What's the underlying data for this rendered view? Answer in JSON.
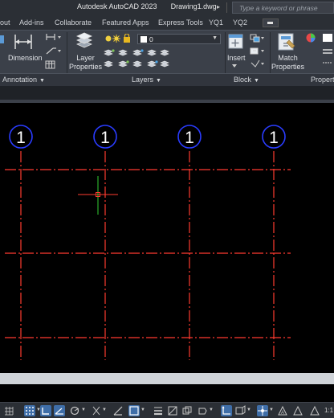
{
  "title_bar": {
    "app_title": "Autodesk AutoCAD 2023",
    "file_name": "Drawing1.dwg",
    "search_placeholder": "Type a keyword or phrase"
  },
  "ribbon_tabs": [
    "out",
    "Add-ins",
    "Collaborate",
    "Featured Apps",
    "Express Tools",
    "YQ1",
    "YQ2"
  ],
  "ribbon": {
    "annotation": {
      "dimension_label": "Dimension",
      "panel_title": "Annotation"
    },
    "layers": {
      "layer_properties_label_1": "Layer",
      "layer_properties_label_2": "Properties",
      "current_layer": "0",
      "panel_title": "Layers"
    },
    "block": {
      "insert_label": "Insert",
      "panel_title": "Block"
    },
    "properties": {
      "match_label_1": "Match",
      "match_label_2": "Properties",
      "panel_title": "Propert"
    }
  },
  "drawing": {
    "grid_bubbles": [
      {
        "label": "1"
      },
      {
        "label": "1"
      },
      {
        "label": "1"
      },
      {
        "label": "1"
      }
    ],
    "grid_color": "#ff3b30",
    "bubble_color": "#2a3cff",
    "crosshair_x_color": "#ff3b30",
    "crosshair_y_color": "#35d035"
  },
  "status_bar": {
    "scale": "1:1"
  },
  "colors": {
    "titlebar": "#2b2f35",
    "ribbon": "#3b4049",
    "status_active": "#3f6ea8"
  }
}
